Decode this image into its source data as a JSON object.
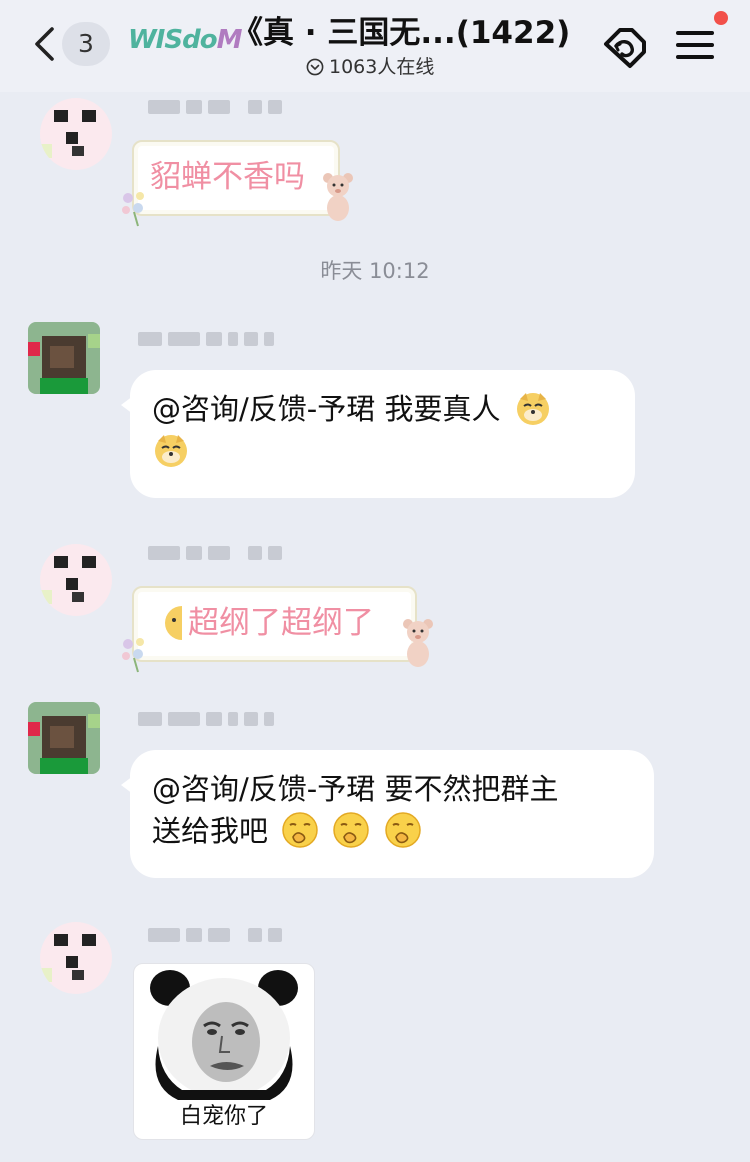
{
  "header": {
    "back_count": "3",
    "brand": "WISdoM",
    "title": "《真 · 三国无...(1422)",
    "online_count": "1063",
    "online_label": "人在线",
    "icons": {
      "back": "chevron-left-icon",
      "online": "chevron-down-circle-icon",
      "tag": "tag-icon",
      "menu": "menu-icon"
    },
    "notification_color": "#f2504a"
  },
  "messages": [
    {
      "type": "sticker",
      "text": "貂蝉不香吗",
      "avatar": "pink"
    },
    {
      "type": "divider",
      "text": "昨天 10:12"
    },
    {
      "type": "text",
      "text": "@咨询/反馈-予珺 我要真人",
      "emojis": [
        "doge-emoji",
        "doge-emoji"
      ],
      "avatar": "green"
    },
    {
      "type": "sticker",
      "text": "超纲了超纲了",
      "avatar": "pink"
    },
    {
      "type": "text",
      "line1": "@咨询/反馈-予珺 要不然把群主",
      "line2": "送给我吧",
      "emojis": [
        "yawn-emoji",
        "yawn-emoji",
        "yawn-emoji"
      ],
      "avatar": "green"
    },
    {
      "type": "meme",
      "caption": "白宠你了",
      "avatar": "pink"
    }
  ],
  "colors": {
    "background": "#e9ecf3",
    "bubble": "#ffffff",
    "sticker_text": "#f08fa3"
  }
}
